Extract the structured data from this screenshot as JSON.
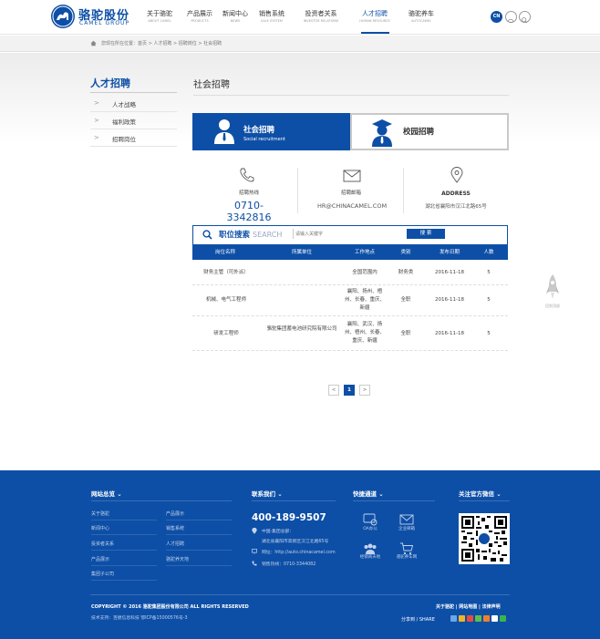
{
  "header": {
    "logo_cn": "骆驼股份",
    "logo_en": "CAMEL GROUP",
    "nav": [
      {
        "cn": "关于骆驼",
        "en": "ABOUT CAMEL"
      },
      {
        "cn": "产品展示",
        "en": "PRODUCTS"
      },
      {
        "cn": "新闻中心",
        "en": "NEWS"
      },
      {
        "cn": "销售系统",
        "en": "SALE SYSTEM"
      },
      {
        "cn": "投资者关系",
        "en": "INVESTOR RELATIONS"
      },
      {
        "cn": "人才招聘",
        "en": "HUMAN RESOURCE"
      },
      {
        "cn": "骆驼养车",
        "en": "AUTOCAMEL"
      }
    ],
    "lang": "CN"
  },
  "breadcrumb": "您现在所在位置：首页 > 人才招聘 > 招聘岗位 > 社会招聘",
  "sidebar": {
    "title": "人才招聘",
    "items": [
      "人才战略",
      "福利政策",
      "招聘岗位"
    ]
  },
  "main": {
    "title": "社会招聘",
    "tabs": [
      {
        "cn": "社会招聘",
        "en": "Social recruitment"
      },
      {
        "cn": "校园招聘"
      }
    ],
    "contact": {
      "phone_label": "招聘热线",
      "phone": "0710-3342816",
      "email_label": "招聘邮箱",
      "email": "HR@CHINACAMEL.COM",
      "address_label": "ADDRESS",
      "address": "湖北省襄阳市汉江北路65号"
    },
    "search": {
      "title": "职位搜索",
      "title_en": "SEARCH",
      "placeholder": "请输入关键字",
      "button": "搜 索"
    },
    "table": {
      "headers": [
        "岗位名称",
        "所属单位",
        "工作地点",
        "类别",
        "发布日期",
        "人数"
      ],
      "rows": [
        {
          "name": "财务主管（可外派）",
          "unit": "",
          "place": "全国范围内",
          "type": "财务类",
          "date": "2016-11-18",
          "count": "5"
        },
        {
          "name": "机械、电气工程师",
          "unit": "",
          "place": "襄阳、扬州、梧州、长春、重庆、新疆",
          "type": "全职",
          "date": "2016-11-18",
          "count": "5"
        },
        {
          "name": "研发工程师",
          "unit": "骆驼集团蓄电池研究院有限公司",
          "place": "襄阳、武汉、扬州、梧州、长春、重庆、新疆",
          "type": "全职",
          "date": "2016-11-18",
          "count": "5"
        }
      ]
    },
    "pagination": {
      "prev": "<",
      "current": "1",
      "next": ">"
    }
  },
  "rocket_label": "回到顶部",
  "footer": {
    "nav_title": "网站总览",
    "links_col1": [
      "关于骆驼",
      "新闻中心",
      "投资者关系",
      "产品展示",
      "集团子公司"
    ],
    "links_col2": [
      "产品展示",
      "销售系统",
      "人才招聘",
      "骆驼养天地"
    ],
    "contact_title": "联系我们",
    "phone": "400-189-9507",
    "hq_label": "中国·集团总部：",
    "hq_address": "湖北省襄阳市高新区汉江北路65号",
    "website": "网址：http://auto.chinacamel.com",
    "sales_line": "销售热线：0710-3344082",
    "quick_title": "快捷通道",
    "quick": [
      "OA办公",
      "企业邮箱",
      "经销商天地",
      "骆驼养车网"
    ],
    "wechat_title": "关注官方微信",
    "copyright": "COPYRIGHT © 2016 骆驼集团股份有限公司 ALL RIGHTS RESERVED",
    "support": "技术支持：百捷信息科技    鄂ICP备15000576号-3",
    "right_links": "关于骆驼 | 网站地图 | 法律声明",
    "share": "分享到 / SHARE"
  }
}
